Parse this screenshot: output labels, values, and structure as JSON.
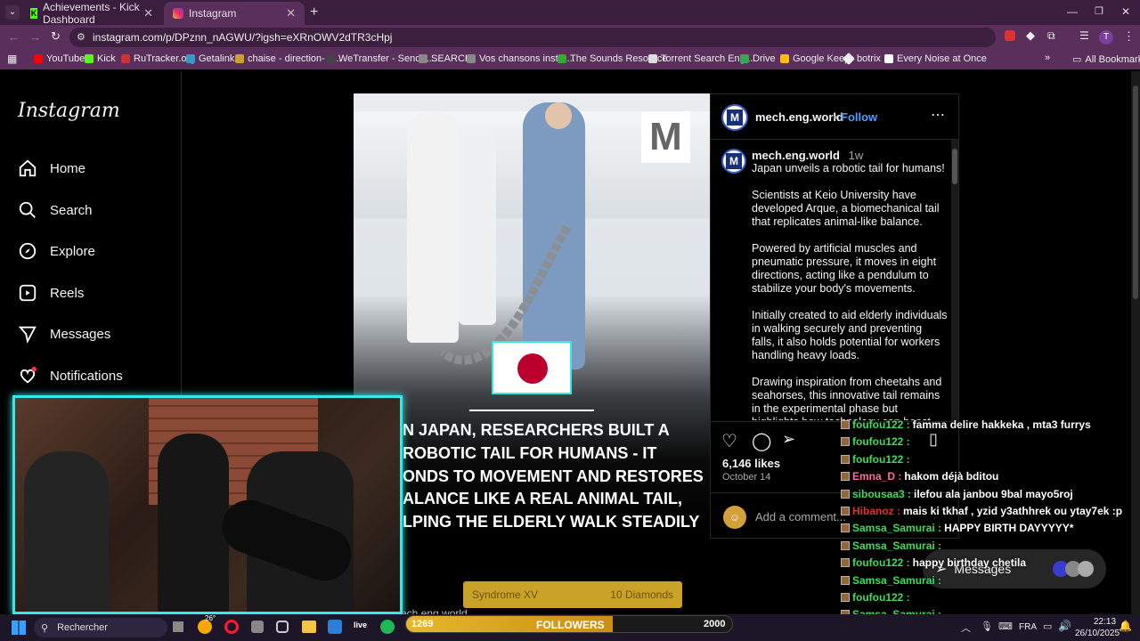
{
  "browser": {
    "tabs": [
      {
        "title": "Achievements - Kick Dashboard"
      },
      {
        "title": "Instagram"
      }
    ],
    "url": "instagram.com/p/DPznn_nAGWU/?igsh=eXRnOWV2dTR3cHpj",
    "bookmarks": [
      "YouTube",
      "Kick",
      "RuTracker.org",
      "Getalink",
      "chaise - direction- b...",
      "WeTransfer - Send L...",
      "SEARCH",
      "Vos chansons instru...",
      "The Sounds Resource",
      "Torrent Search Engi...",
      "Drive",
      "Google Keep",
      "botrix",
      "Every Noise at Once"
    ],
    "all_bookmarks": "All Bookmarks",
    "profile_initial": "T"
  },
  "instagram": {
    "logo": "Instagram",
    "nav": [
      "Home",
      "Search",
      "Explore",
      "Reels",
      "Messages",
      "Notifications"
    ],
    "post": {
      "account": "mech.eng.world",
      "follow": "Follow",
      "dot": "•",
      "time": "1w",
      "caption": [
        "Japan unveils a robotic tail for humans!",
        "Scientists at Keio University have developed Arque, a biomechanical tail that replicates animal-like balance.",
        "Powered by artificial muscles and pneumatic pressure, it moves in eight directions, acting like a pendulum to stabilize your body's movements.",
        "Initially created to aid elderly individuals in walking securely and preventing falls, it also holds potential for workers handling heavy loads.",
        "Drawing inspiration from cheetahs and seahorses, this innovative tail remains in the experimental phase but highlights how technology can boost mobility and"
      ],
      "likes": "6,146 likes",
      "date": "October 14",
      "comment_placeholder": "Add a comment...",
      "image_text_lines": [
        "N JAPAN, RESEARCHERS BUILT A",
        "ROBOTIC TAIL FOR HUMANS - IT",
        "ONDS TO MOVEMENT AND RESTORES",
        "ALANCE LIKE A REAL ANIMAL TAIL,",
        "LPING THE ELDERLY WALK STEADILY"
      ],
      "watermark": "M"
    },
    "messages_pill": "Messages",
    "bottom_text": "mech.eng.world"
  },
  "stream": {
    "chat": [
      {
        "user": "foufou122",
        "color": "#3ddc5b",
        "msg": "famma delire hakkeka , mta3 furrys"
      },
      {
        "user": "foufou122",
        "color": "#3ddc5b",
        "msg": ""
      },
      {
        "user": "foufou122",
        "color": "#3ddc5b",
        "msg": ""
      },
      {
        "user": "Emna_D",
        "color": "#ff6b9a",
        "msg": "hakom déjà bditou"
      },
      {
        "user": "sibousaa3",
        "color": "#3ddc5b",
        "msg": "ilefou ala janbou 9bal mayo5roj"
      },
      {
        "user": "Hibanoz",
        "color": "#e03030",
        "msg": "mais ki tkhaf , yzid y3athhrek ou ytay7ek :p"
      },
      {
        "user": "Samsa_Samurai",
        "color": "#3ddc5b",
        "msg": "HAPPY BIRTH DAYYYYY*"
      },
      {
        "user": "Samsa_Samurai",
        "color": "#3ddc5b",
        "msg": ""
      },
      {
        "user": "foufou122",
        "color": "#3ddc5b",
        "msg": "happy birthday chetila"
      },
      {
        "user": "Samsa_Samurai",
        "color": "#3ddc5b",
        "msg": ""
      },
      {
        "user": "foufou122",
        "color": "#3ddc5b",
        "msg": ""
      },
      {
        "user": "Samsa_Samurai",
        "color": "#3ddc5b",
        "msg": ""
      },
      {
        "user": "Samsa_Samurai",
        "color": "#3ddc5b",
        "msg": ""
      }
    ],
    "goal": {
      "label": "FOLLOWERS",
      "current": "1269",
      "target": "2000",
      "progress": 0.6345
    },
    "alert": {
      "name": "Syndrome XV",
      "amount": "10 Diamonds"
    }
  },
  "taskbar": {
    "search": "Rechercher",
    "weather": "26°",
    "lang": "FRA",
    "time": "22:13",
    "date": "26/10/2025"
  }
}
